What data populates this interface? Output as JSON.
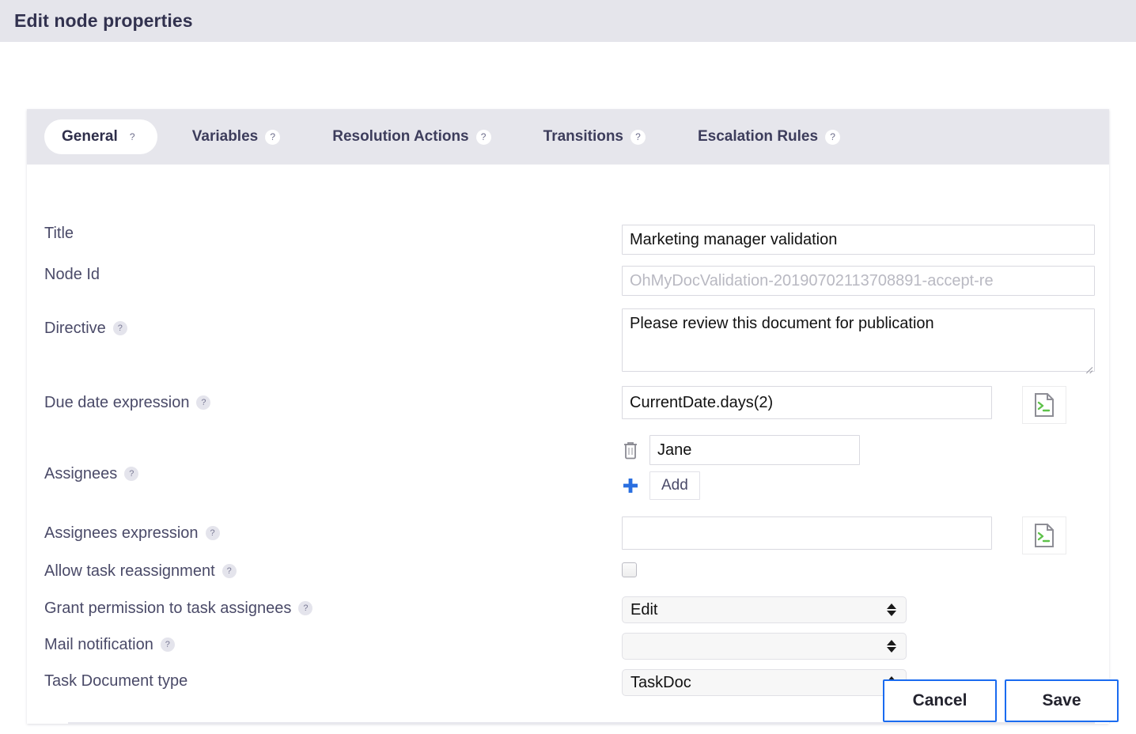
{
  "window": {
    "title": "Edit node properties"
  },
  "tabs": [
    {
      "label": "General",
      "help": "?",
      "active": true
    },
    {
      "label": "Variables",
      "help": "?",
      "active": false
    },
    {
      "label": "Resolution Actions",
      "help": "?",
      "active": false
    },
    {
      "label": "Transitions",
      "help": "?",
      "active": false
    },
    {
      "label": "Escalation Rules",
      "help": "?",
      "active": false
    }
  ],
  "form": {
    "title": {
      "label": "Title",
      "value": "Marketing manager validation"
    },
    "node_id": {
      "label": "Node Id",
      "value": "OhMyDocValidation-20190702113708891-accept-re"
    },
    "directive": {
      "label": "Directive",
      "help": "?",
      "value": "Please review this document for publication"
    },
    "due_date_expression": {
      "label": "Due date expression",
      "help": "?",
      "value": "CurrentDate.days(2)",
      "editor_icon": "script-editor-icon"
    },
    "assignees": {
      "label": "Assignees",
      "help": "?",
      "values": [
        "Jane"
      ],
      "delete_icon": "trash-icon",
      "add_icon": "plus-icon",
      "add_label": "Add"
    },
    "assignees_expression": {
      "label": "Assignees expression",
      "help": "?",
      "value": "",
      "editor_icon": "script-editor-icon"
    },
    "allow_task_reassignment": {
      "label": "Allow task reassignment",
      "help": "?",
      "checked": false
    },
    "grant_permission": {
      "label": "Grant permission to task assignees",
      "help": "?",
      "value": "Edit"
    },
    "mail_notification": {
      "label": "Mail notification",
      "help": "?",
      "value": ""
    },
    "task_document_type": {
      "label": "Task Document type",
      "value": "TaskDoc"
    }
  },
  "footer": {
    "cancel_label": "Cancel",
    "save_label": "Save"
  },
  "colors": {
    "titlebar_bg": "#e5e5eb",
    "tabbar_bg": "#e6e6ec",
    "accent_blue": "#1a6bf0",
    "plus_blue": "#2a6fe0",
    "script_green": "#5ec24a",
    "text_dark": "#32324f"
  }
}
